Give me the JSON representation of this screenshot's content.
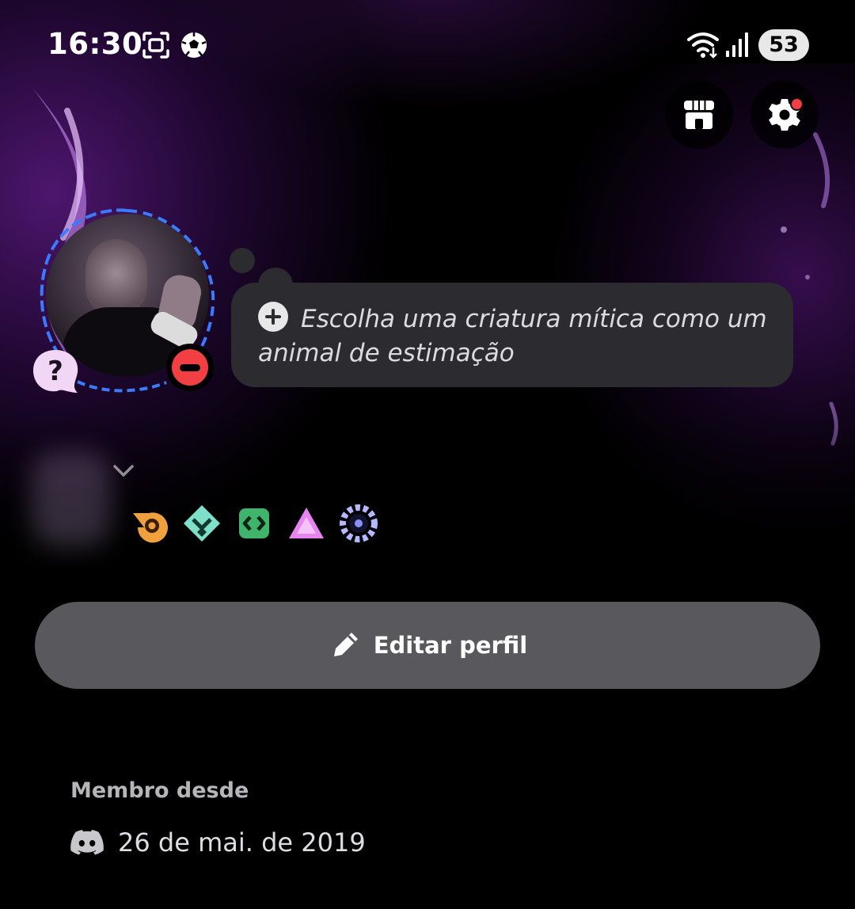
{
  "status_bar": {
    "time": "16:30",
    "battery": "53",
    "icons": [
      "screen-record-icon",
      "soccer-ball-icon",
      "wifi-icon",
      "signal-icon"
    ]
  },
  "header": {
    "shop_icon": "shop-icon",
    "settings_icon": "settings-gear-icon",
    "settings_has_notification": true
  },
  "profile": {
    "status": "do-not-disturb",
    "custom_status_prompt": "Escolha uma criatura mítica como um animal de estimação",
    "badges": [
      "hypesquad-bravery-icon",
      "early-supporter-icon",
      "active-developer-icon",
      "nitro-icon",
      "quest-badge-icon"
    ],
    "edit_label": "Editar perfil"
  },
  "member_since": {
    "title": "Membro desde",
    "date": "26 de mai. de 2019"
  },
  "colors": {
    "background": "#000000",
    "bubble": "#2b2b30",
    "button": "#58585d",
    "dnd_red": "#f23f43",
    "accent_purple": "#8c28c8"
  }
}
